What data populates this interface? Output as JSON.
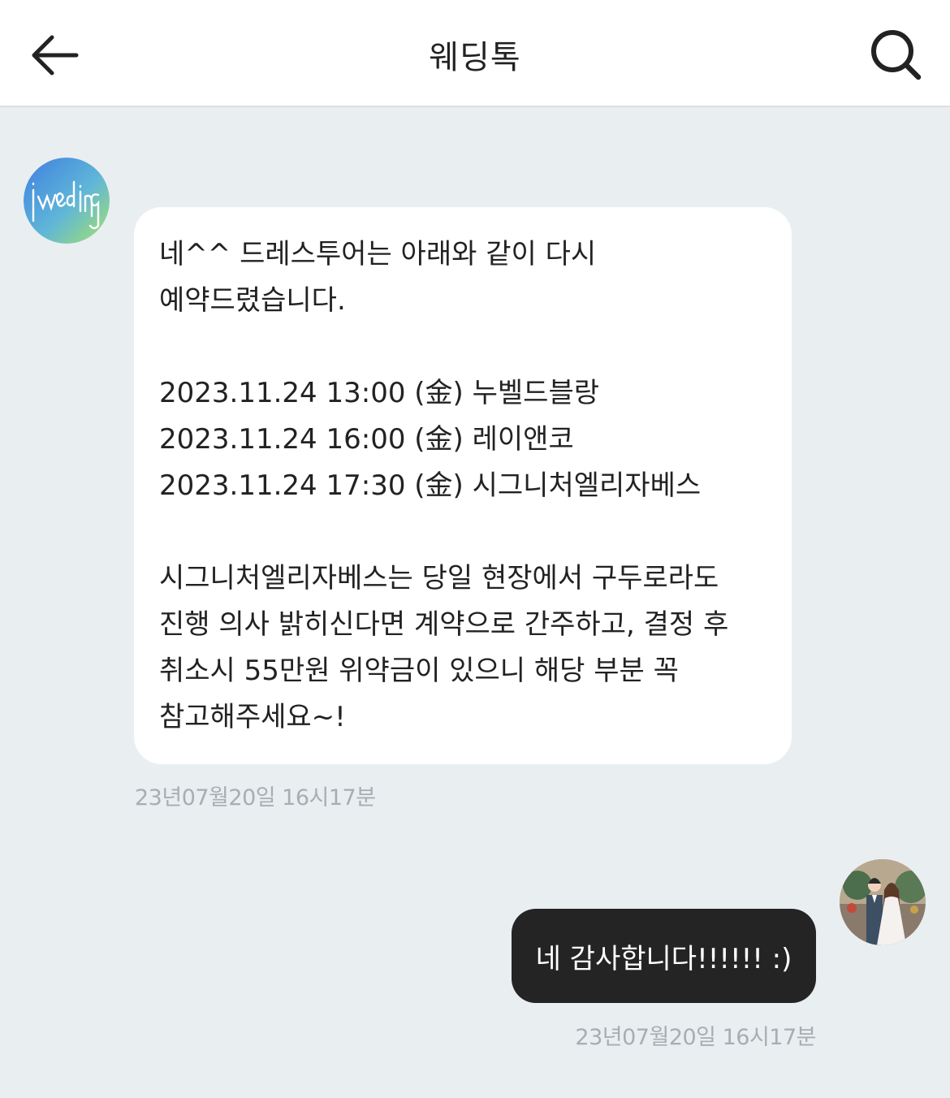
{
  "header": {
    "title": "웨딩톡",
    "back_icon": "arrow-left-icon",
    "search_icon": "search-icon"
  },
  "messages": [
    {
      "sender": "agency",
      "avatar": "jwedding-logo",
      "text": "네^^ 드레스투어는 아래와 같이 다시 예약드렸습니다.\n\n2023.11.24 13:00 (金) 누벨드블랑\n2023.11.24 16:00 (金) 레이앤코\n2023.11.24 17:30 (金) 시그니처엘리자베스\n\n시그니처엘리자베스는 당일 현장에서 구두로라도 진행 의사 밝히신다면 계약으로 간주하고, 결정 후 취소시 55만원 위약금이 있으니 해당 부분 꼭 참고해주세요~!",
      "time": "23년07월20일 16시17분"
    },
    {
      "sender": "me",
      "avatar": "couple-photo",
      "text": "네 감사합니다!!!!!! :)",
      "time": "23년07월20일 16시17분"
    }
  ],
  "colors": {
    "background": "#e9eef1",
    "incoming_bubble": "#ffffff",
    "outgoing_bubble": "#242424",
    "timestamp": "#a7adb3"
  }
}
